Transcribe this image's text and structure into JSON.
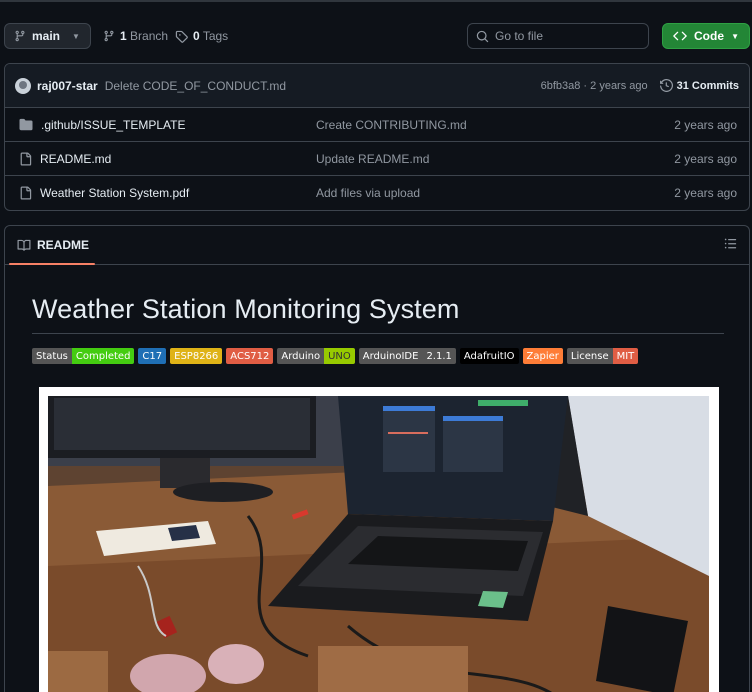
{
  "toolbar": {
    "branch": "main",
    "branches_count": "1",
    "branches_label": "Branch",
    "tags_count": "0",
    "tags_label": "Tags",
    "goto_placeholder": "Go to file",
    "code_label": "Code"
  },
  "commit": {
    "user": "raj007-star",
    "message": "Delete CODE_OF_CONDUCT.md",
    "hash_time": "6bfb3a8 · 2 years ago",
    "commits_count": "31 Commits"
  },
  "files": [
    {
      "type": "folder",
      "name": ".github/ISSUE_TEMPLATE",
      "commit": "Create CONTRIBUTING.md",
      "age": "2 years ago"
    },
    {
      "type": "file",
      "name": "README.md",
      "commit": "Update README.md",
      "age": "2 years ago"
    },
    {
      "type": "file",
      "name": "Weather Station System.pdf",
      "commit": "Add files via upload",
      "age": "2 years ago"
    }
  ],
  "readme": {
    "tab_label": "README",
    "title": "Weather Station Monitoring System",
    "badges": [
      {
        "left": "Status",
        "right": "Completed",
        "color": "#4c1"
      },
      {
        "left": "",
        "right": "C17",
        "color": "#1f6fb5"
      },
      {
        "left": "",
        "right": "ESP8266",
        "color": "#dfb317"
      },
      {
        "left": "",
        "right": "ACS712",
        "color": "#e05d44"
      },
      {
        "left": "Arduino",
        "right": "UNO",
        "color": "#97ca00"
      },
      {
        "left": "ArduinoIDE",
        "right": "2.1.1",
        "color": "#555"
      },
      {
        "left": "",
        "right": "AdafruitIO",
        "color": "#000000"
      },
      {
        "left": "",
        "right": "Zapier",
        "color": "#fe7d37"
      },
      {
        "left": "License",
        "right": "MIT",
        "color": "#e05d44"
      }
    ]
  },
  "colors": {
    "background": "#0d1117",
    "border": "#3d444d",
    "code_button": "#238636",
    "readme_tab_accent": "#f78166"
  },
  "icons": [
    "git-branch-icon",
    "tag-icon",
    "search-icon",
    "code-icon",
    "history-icon",
    "folder-icon",
    "file-icon",
    "book-icon",
    "list-icon",
    "avatar"
  ]
}
